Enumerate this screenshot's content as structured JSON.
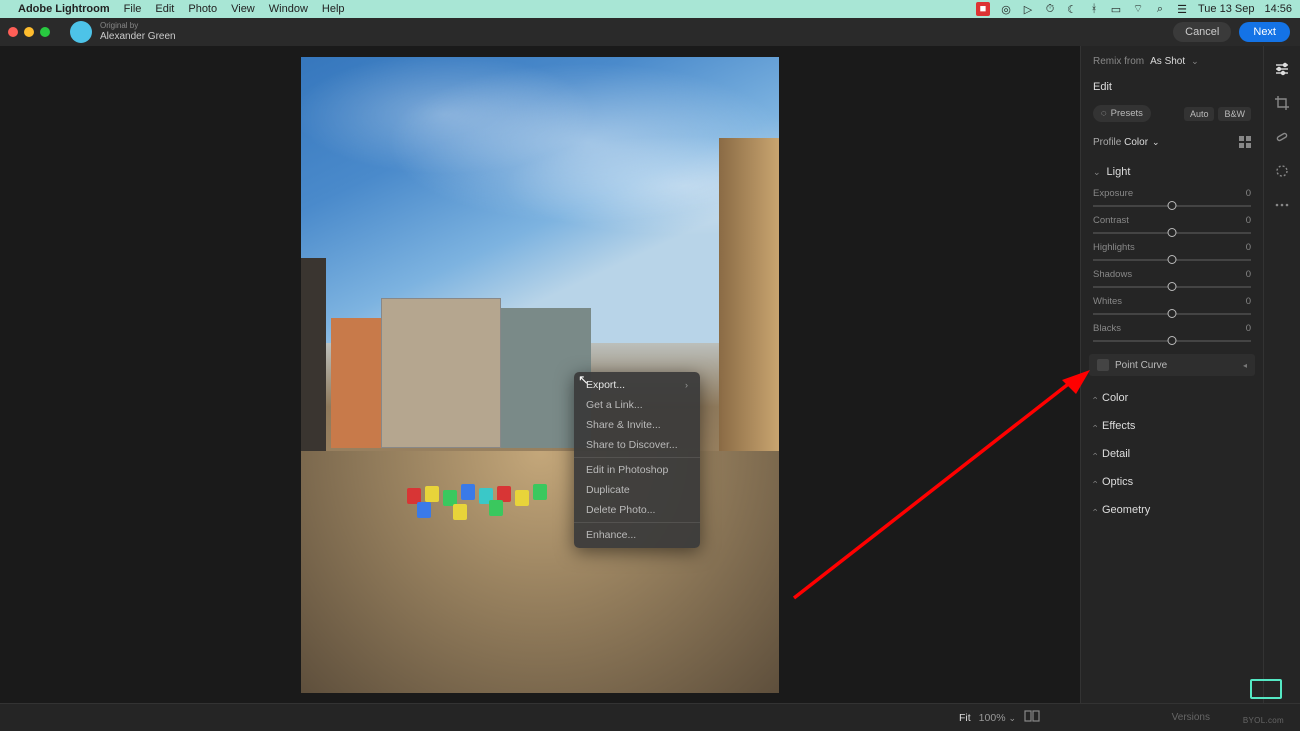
{
  "mac_menu": {
    "app": "Adobe Lightroom",
    "items": [
      "File",
      "Edit",
      "Photo",
      "View",
      "Window",
      "Help"
    ],
    "date": "Tue 13 Sep",
    "time": "14:56"
  },
  "user": {
    "byline": "Original by",
    "name": "Alexander Green"
  },
  "top_buttons": {
    "cancel": "Cancel",
    "next": "Next"
  },
  "context_menu": {
    "items": [
      "Export...",
      "Get a Link...",
      "Share & Invite...",
      "Share to Discover...",
      "Edit in Photoshop",
      "Duplicate",
      "Delete Photo...",
      "Enhance..."
    ]
  },
  "remix": {
    "label": "Remix from",
    "value": "As Shot"
  },
  "edit_panel": {
    "title": "Edit",
    "presets": "Presets",
    "auto": "Auto",
    "bw": "B&W",
    "profile_label": "Profile",
    "profile_value": "Color",
    "point_curve": "Point Curve",
    "sections": {
      "light": "Light",
      "color": "Color",
      "effects": "Effects",
      "detail": "Detail",
      "optics": "Optics",
      "geometry": "Geometry"
    },
    "sliders": [
      {
        "name": "Exposure",
        "value": "0"
      },
      {
        "name": "Contrast",
        "value": "0"
      },
      {
        "name": "Highlights",
        "value": "0"
      },
      {
        "name": "Shadows",
        "value": "0"
      },
      {
        "name": "Whites",
        "value": "0"
      },
      {
        "name": "Blacks",
        "value": "0"
      }
    ]
  },
  "bottom": {
    "fit": "Fit",
    "zoom": "100%",
    "versions": "Versions"
  },
  "watermark": "BYOL.com"
}
